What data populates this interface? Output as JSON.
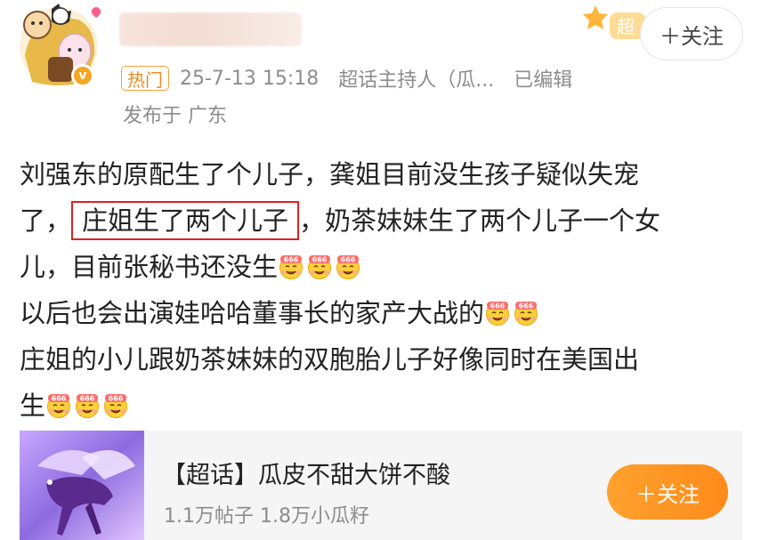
{
  "header": {
    "follow_label": "＋关注",
    "super_tag": "超",
    "verify_mark": "v",
    "meta": {
      "hot_badge": "热门",
      "time": "25-7-13 15:18",
      "source": "超话主持人（瓜...",
      "edited": "已编辑"
    },
    "location": "发布于 广东"
  },
  "body": {
    "line1": "刘强东的原配生了个儿子，龚姐目前没生孩子疑似失宠",
    "line2_a": "了，",
    "line2_highlight": "庄姐生了两个儿子",
    "line2_b": "，奶茶妹妹生了两个儿子一个女",
    "line3": "儿，目前张秘书还没生",
    "line4": "以后也会出演娃哈哈董事长的家产大战的",
    "line5": "庄姐的小儿跟奶茶妹妹的双胞胎儿子好像同时在美国出",
    "line6": "生",
    "emoji_name": "emoji-666-face"
  },
  "topic_card": {
    "title": "【超话】瓜皮不甜大饼不酸",
    "stats": "1.1万帖子 1.8万小瓜籽",
    "follow_label": "＋关注"
  },
  "colors": {
    "accent_orange": "#ff9a27",
    "highlight_red": "#e02020",
    "meta_gray": "#8c8c8c"
  }
}
